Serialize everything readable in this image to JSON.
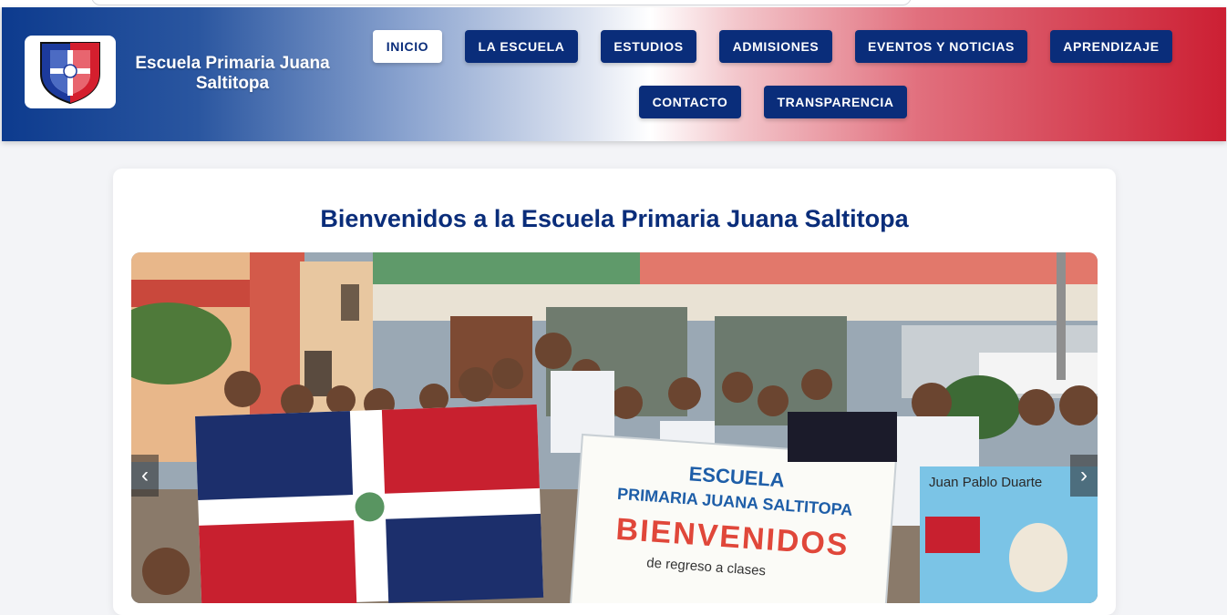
{
  "site": {
    "title": "Escuela Primaria Juana Saltitopa",
    "logo_icon": "school-shield-logo"
  },
  "nav": {
    "items": [
      {
        "label": "INICIO",
        "active": true
      },
      {
        "label": "LA ESCUELA",
        "active": false
      },
      {
        "label": "ESTUDIOS",
        "active": false
      },
      {
        "label": "ADMISIONES",
        "active": false
      },
      {
        "label": "EVENTOS Y NOTICIAS",
        "active": false
      },
      {
        "label": "APRENDIZAJE",
        "active": false
      },
      {
        "label": "CONTACTO",
        "active": false
      },
      {
        "label": "TRANSPARENCIA",
        "active": false
      }
    ]
  },
  "main": {
    "welcome_heading": "Bienvenidos a la Escuela Primaria Juana Saltitopa"
  },
  "carousel": {
    "prev_icon": "‹",
    "next_icon": "›",
    "banner": {
      "line1": "ESCUELA",
      "line2": "PRIMARIA JUANA SALTITOPA",
      "line3": "BIENVENIDOS",
      "line4": "de regreso a clases"
    },
    "poster_title": "Juan Pablo Duarte"
  },
  "colors": {
    "brand_blue": "#0a2d7a",
    "brand_red": "#cc1f33"
  }
}
